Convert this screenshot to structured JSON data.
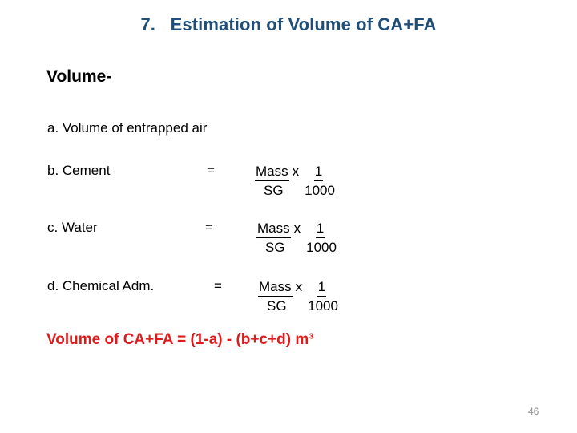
{
  "slide": {
    "title": "7.   Estimation of Volume of CA+FA",
    "title_color": "#1F4E79",
    "heading": "Volume-",
    "item_a": "a. Volume of entrapped air",
    "result": "Volume of CA+FA = (1-a) - (b+c+d) m³",
    "result_color": "#DD1B1B",
    "page_number": "46",
    "background": "#FFFFFF"
  },
  "rows": [
    {
      "label": "b. Cement",
      "equals": "=",
      "left_fraction": {
        "numerator": "Mass",
        "denominator": "SG"
      },
      "operator": "x",
      "right_fraction": {
        "numerator": "1",
        "denominator": "1000"
      }
    },
    {
      "label": "c. Water",
      "equals": "=",
      "left_fraction": {
        "numerator": "Mass",
        "denominator": "SG"
      },
      "operator": "x",
      "right_fraction": {
        "numerator": "1",
        "denominator": "1000"
      }
    },
    {
      "label": "d. Chemical Adm.",
      "equals": "=",
      "left_fraction": {
        "numerator": "Mass",
        "denominator": "SG"
      },
      "operator": "x",
      "right_fraction": {
        "numerator": "1",
        "denominator": "1000"
      }
    }
  ]
}
